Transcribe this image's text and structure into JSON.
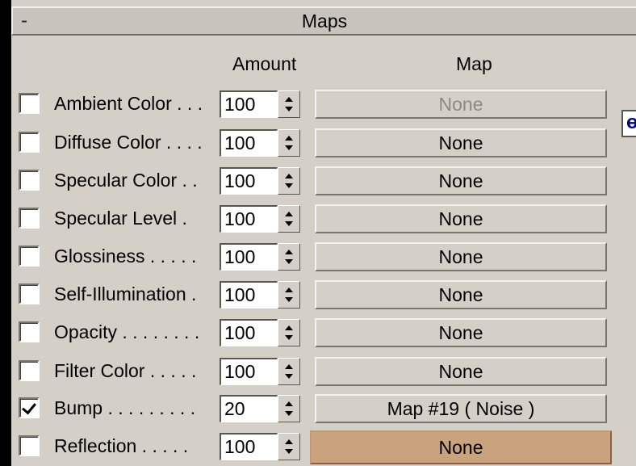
{
  "rollout": {
    "toggle": "-",
    "title": "Maps"
  },
  "columns": {
    "amount": "Amount",
    "map": "Map"
  },
  "rows": [
    {
      "label": "Ambient Color . . .",
      "checked": false,
      "amount": "100",
      "map": "None"
    },
    {
      "label": "Diffuse Color . . . .",
      "checked": false,
      "amount": "100",
      "map": "None"
    },
    {
      "label": "Specular Color  . .",
      "checked": false,
      "amount": "100",
      "map": "None"
    },
    {
      "label": "Specular Level  .",
      "checked": false,
      "amount": "100",
      "map": "None"
    },
    {
      "label": "Glossiness  . . . . .",
      "checked": false,
      "amount": "100",
      "map": "None"
    },
    {
      "label": "Self-Illumination .",
      "checked": false,
      "amount": "100",
      "map": "None"
    },
    {
      "label": "Opacity . . . . . . . .",
      "checked": false,
      "amount": "100",
      "map": "None"
    },
    {
      "label": "Filter Color  . . . . .",
      "checked": false,
      "amount": "100",
      "map": "None"
    },
    {
      "label": "Bump  . . . . . . . . .",
      "checked": true,
      "amount": "20",
      "map": "Map #19  ( Noise )"
    },
    {
      "label": "Reflection  . . . . .",
      "checked": false,
      "amount": "100",
      "map": "None"
    }
  ],
  "side_lock_glyph": "ɵ"
}
